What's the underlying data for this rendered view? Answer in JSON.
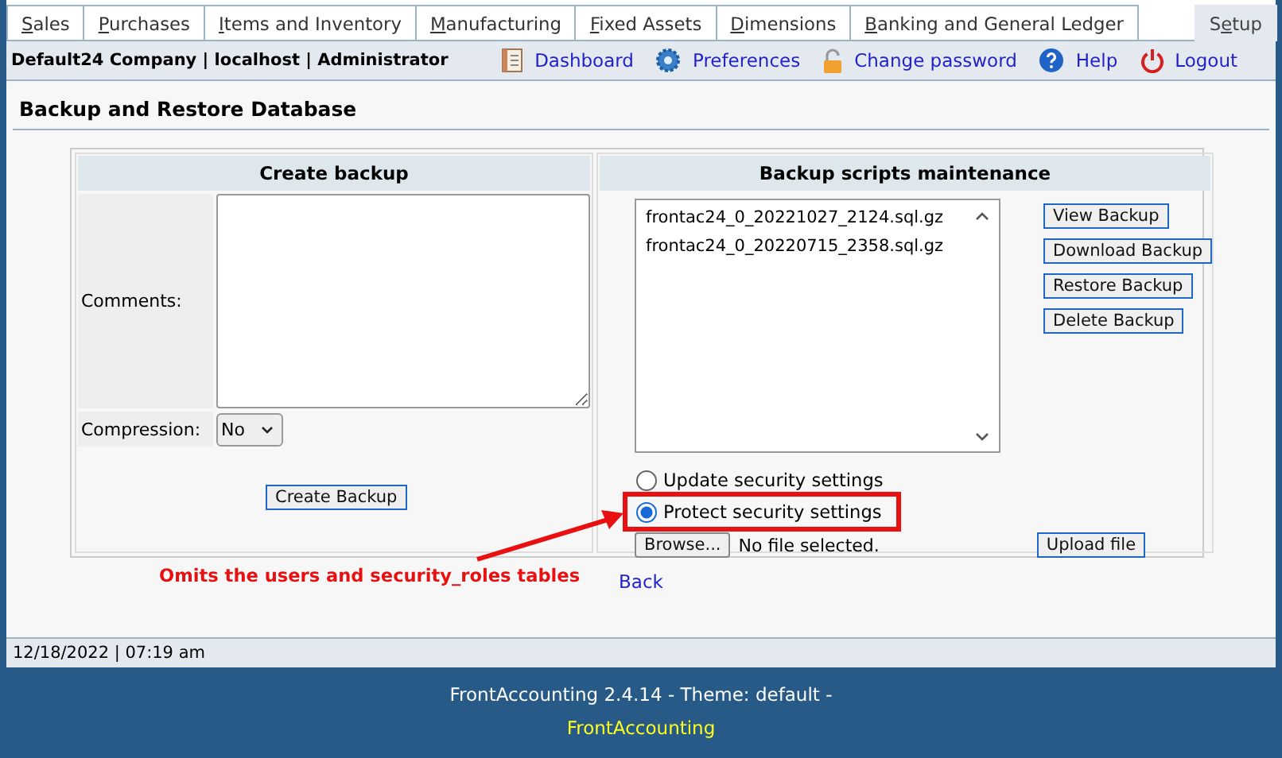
{
  "tabs": [
    {
      "key": "S",
      "after": "ales",
      "selected": false
    },
    {
      "key": "P",
      "after": "urchases",
      "selected": false
    },
    {
      "key": "I",
      "after": "tems and Inventory",
      "selected": false
    },
    {
      "key": "M",
      "after": "anufacturing",
      "selected": false
    },
    {
      "key": "F",
      "after": "ixed Assets",
      "selected": false
    },
    {
      "key": "D",
      "after": "imensions",
      "selected": false
    },
    {
      "key": "B",
      "after": "anking and General Ledger",
      "selected": false
    },
    {
      "before": "S",
      "key": "e",
      "after": "tup",
      "selected": true
    }
  ],
  "header": {
    "company": "Default24 Company | localhost | Administrator",
    "links": [
      {
        "label": "Dashboard",
        "kind": "dashboard"
      },
      {
        "label": "Preferences",
        "kind": "preferences"
      },
      {
        "label": "Change password",
        "kind": "password"
      },
      {
        "label": "Help",
        "kind": "help"
      },
      {
        "label": "Logout",
        "kind": "logout"
      }
    ]
  },
  "page_title": "Backup and Restore Database",
  "create_backup": {
    "heading": "Create backup",
    "comments_label": "Comments:",
    "compression_label": "Compression:",
    "compression_value": "No",
    "button": "Create Backup"
  },
  "maintenance": {
    "heading": "Backup scripts maintenance",
    "files": [
      "frontac24_0_20221027_2124.sql.gz",
      "frontac24_0_20220715_2358.sql.gz"
    ],
    "buttons": [
      "View Backup",
      "Download Backup",
      "Restore Backup",
      "Delete Backup"
    ],
    "options": [
      {
        "label": "Update security settings",
        "selected": false
      },
      {
        "label": "Protect security settings",
        "selected": true
      }
    ],
    "browse_button": "Browse...",
    "file_status": "No file selected.",
    "upload_button": "Upload file"
  },
  "back_link": "Back",
  "status_bar": "12/18/2022 | 07:19 am",
  "footer": {
    "version": "FrontAccounting 2.4.14 - Theme: default -",
    "link": "FrontAccounting"
  },
  "annotation": {
    "text": "Omits the users and security_roles tables"
  }
}
